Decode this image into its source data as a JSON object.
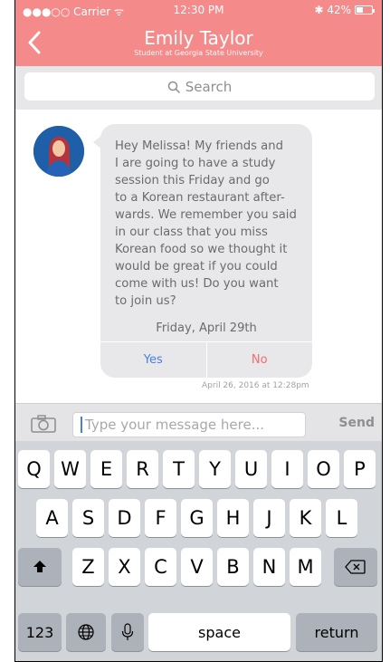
{
  "status_bar": {
    "left": "●●●○○ Carrier ᯤ",
    "time": "12:30 PM",
    "battery_text": "✱ 42%",
    "battery_level": 0.42
  },
  "header": {
    "title": "Emily Taylor",
    "subtitle": "Student at Georgia State University"
  },
  "search": {
    "placeholder": "Search"
  },
  "message": {
    "text": "Hey Melissa! My friends and\nI are going to have a study\nsession this Friday and go\nto a Korean restaurant after-\nwards. We remember you said\nin our class that you miss\nKorean food so we thought it\nwould be great if you could\ncome with us! Do you want\nto join us?",
    "date": "Friday, April 29th",
    "yes_label": "Yes",
    "no_label": "No",
    "timestamp": "April 26, 2016 at 12:28pm"
  },
  "composer": {
    "placeholder": "Type your message here...",
    "send_label": "Send"
  },
  "keyboard": {
    "row1": [
      "Q",
      "W",
      "E",
      "R",
      "T",
      "Y",
      "U",
      "I",
      "O",
      "P"
    ],
    "row2": [
      "A",
      "S",
      "D",
      "F",
      "G",
      "H",
      "J",
      "K",
      "L"
    ],
    "row3": [
      "Z",
      "X",
      "C",
      "V",
      "B",
      "N",
      "M"
    ],
    "numbers_label": "123",
    "space_label": "space",
    "return_label": "return"
  },
  "colors": {
    "header": "#f58a8a",
    "yes": "#4a7fd8",
    "no": "#f26c6c"
  }
}
